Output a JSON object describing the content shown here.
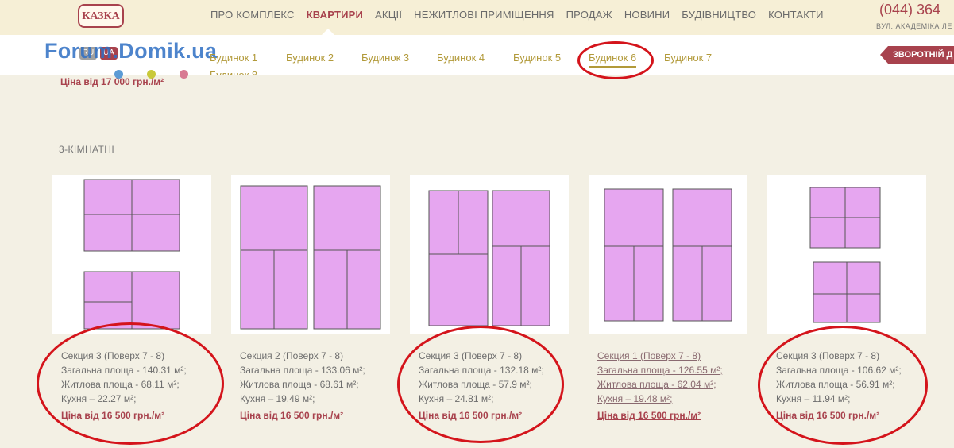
{
  "header": {
    "logo_text": "КАЗКА",
    "nav": [
      "ПРО КОМПЛЕКС",
      "КВАРТИРИ",
      "АКЦІЇ",
      "НЕЖИТЛОВІ ПРИМІЩЕННЯ",
      "ПРОДАЖ",
      "НОВИНИ",
      "БУДІВНИЦТВО",
      "КОНТАКТИ"
    ],
    "active_nav": "КВАРТИРИ",
    "phone": "(044) 364",
    "address": "ВУЛ. АКАДЕМІКА ЛЕ"
  },
  "subbar": {
    "watermark": "Forum.Domik.ua",
    "lang": [
      "RU",
      "UA"
    ],
    "buildings": [
      "Будинок 1",
      "Будинок 2",
      "Будинок 3",
      "Будинок 4",
      "Будинок 5",
      "Будинок 6",
      "Будинок 7",
      "Будинок 8"
    ],
    "active_building": "Будинок 6",
    "feedback_label": "ЗВОРОТНІЙ Д",
    "dot_colors": [
      "#5b9bd5",
      "#c9c93a",
      "#d87a92"
    ]
  },
  "top_price": "Ціна від 17 000 грн./м²",
  "section_title": "3-КІМНАТНІ",
  "colors": {
    "accent": "#a8424d",
    "gold": "#b29a3a",
    "plan_room": "#e6a6f0",
    "annotation": "#d4141b"
  },
  "cards": [
    {
      "section": "Секция 3 (Поверх 7 - 8)",
      "total": "Загальна площа - 140.31 м²;",
      "living": "Житлова площа - 68.11 м²;",
      "kitchen": "Кухня – 22.27 м²;",
      "price": "Ціна від 16 500 грн./м²"
    },
    {
      "section": "Секция 2 (Поверх 7 - 8)",
      "total": "Загальна площа - 133.06 м²;",
      "living": "Житлова площа - 68.61 м²;",
      "kitchen": "Кухня – 19.49 м²;",
      "price": "Ціна від 16 500 грн./м²"
    },
    {
      "section": "Секция 3 (Поверх 7 - 8)",
      "total": "Загальна площа - 132.18 м²;",
      "living": "Житлова площа - 57.9 м²;",
      "kitchen": "Кухня – 24.81 м²;",
      "price": "Ціна від 16 500 грн./м²"
    },
    {
      "section": "Секция 1 (Поверх 7 - 8)",
      "total": "Загальна площа - 126.55 м²;",
      "living": "Житлова площа - 62.04 м²;",
      "kitchen": "Кухня – 19.48 м²;",
      "price": "Ціна від 16 500 грн./м²"
    },
    {
      "section": "Секция 3 (Поверх 7 - 8)",
      "total": "Загальна площа - 106.62 м²;",
      "living": "Житлова площа - 56.91 м²;",
      "kitchen": "Кухня – 11.94 м²;",
      "price": "Ціна від 16 500 грн./м²"
    }
  ]
}
